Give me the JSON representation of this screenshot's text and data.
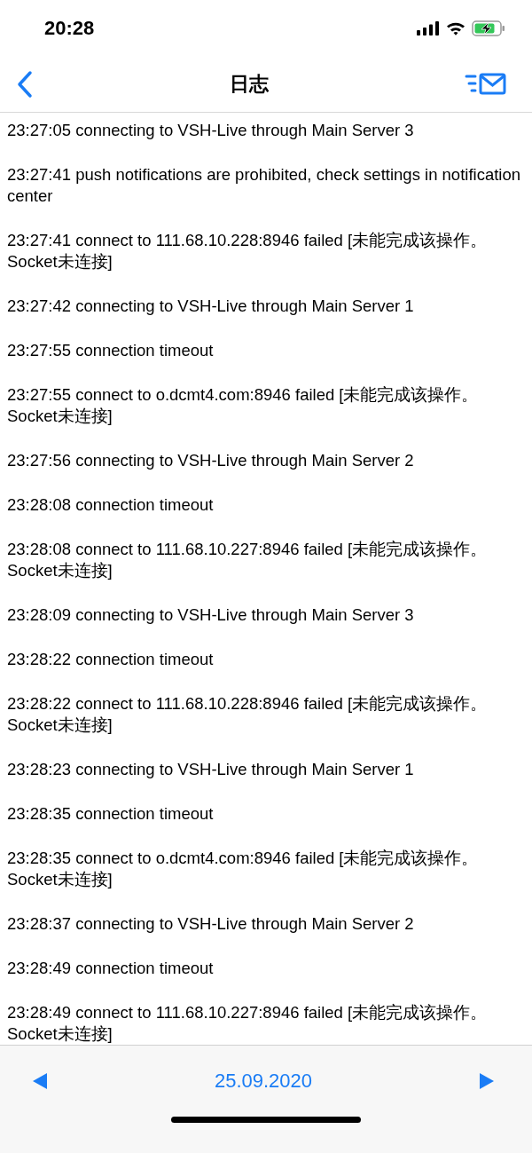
{
  "status_bar": {
    "time": "20:28"
  },
  "nav_bar": {
    "title": "日志"
  },
  "log": [
    "23:27:05 connecting to VSH-Live through Main Server 3",
    "23:27:41 push notifications are prohibited, check settings in notification center",
    "23:27:41 connect to 111.68.10.228:8946 failed [未能完成该操作。Socket未连接]",
    "23:27:42 connecting to VSH-Live through Main Server 1",
    "23:27:55 connection timeout",
    "23:27:55 connect to o.dcmt4.com:8946 failed [未能完成该操作。Socket未连接]",
    "23:27:56 connecting to VSH-Live through Main Server 2",
    "23:28:08 connection timeout",
    "23:28:08 connect to 111.68.10.227:8946 failed [未能完成该操作。Socket未连接]",
    "23:28:09 connecting to VSH-Live through Main Server 3",
    "23:28:22 connection timeout",
    "23:28:22 connect to 111.68.10.228:8946 failed [未能完成该操作。Socket未连接]",
    "23:28:23 connecting to VSH-Live through Main Server 1",
    "23:28:35 connection timeout",
    "23:28:35 connect to o.dcmt4.com:8946 failed [未能完成该操作。Socket未连接]",
    "23:28:37 connecting to VSH-Live through Main Server 2",
    "23:28:49 connection timeout",
    "23:28:49 connect to 111.68.10.227:8946 failed [未能完成该操作。Socket未连接]"
  ],
  "toolbar": {
    "date": "25.09.2020"
  }
}
